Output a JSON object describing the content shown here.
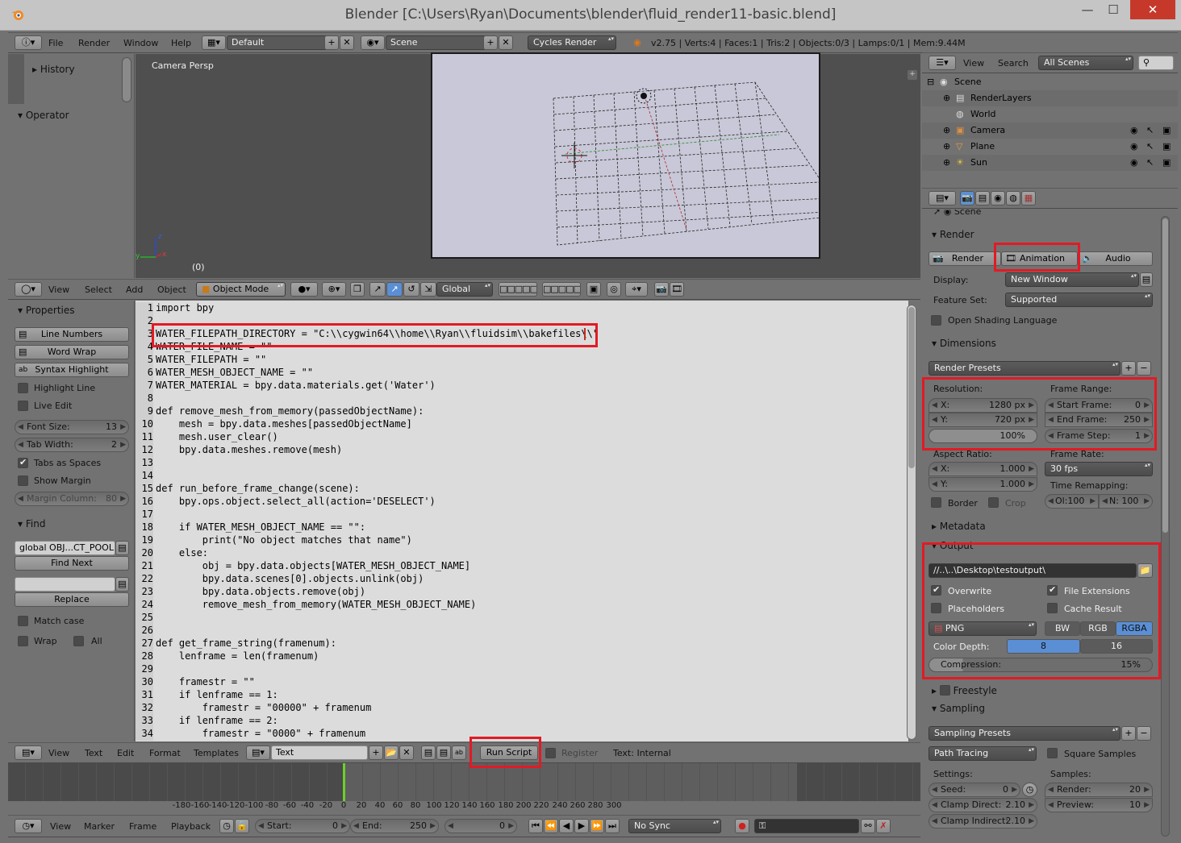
{
  "window": {
    "title": "Blender [C:\\Users\\Ryan\\Documents\\blender\\fluid_render11-basic.blend]",
    "min": "—",
    "max": "☐",
    "close": "✕"
  },
  "topmenu": {
    "file": "File",
    "render": "Render",
    "window": "Window",
    "help": "Help",
    "layout": "Default",
    "scene": "Scene",
    "engine": "Cycles Render",
    "stats": "v2.75 | Verts:4 | Faces:1 | Tris:2 | Objects:0/3 | Lamps:0/1 | Mem:9.44M"
  },
  "toolshelf": {
    "history": "History",
    "operator": "Operator"
  },
  "viewport": {
    "label": "Camera Persp",
    "frame": "(0)",
    "x": "x",
    "y": "y",
    "z": "z"
  },
  "view3d_header": {
    "view": "View",
    "select": "Select",
    "add": "Add",
    "object": "Object",
    "mode": "Object Mode",
    "orientation": "Global"
  },
  "text_props": {
    "properties": "Properties",
    "line_numbers": "Line Numbers",
    "word_wrap": "Word Wrap",
    "syntax_highlight": "Syntax Highlight",
    "highlight_line": "Highlight Line",
    "live_edit": "Live Edit",
    "font_size_label": "Font Size:",
    "font_size": "13",
    "tab_width_label": "Tab Width:",
    "tab_width": "2",
    "tabs_as_spaces": "Tabs as Spaces",
    "show_margin": "Show Margin",
    "margin_column_label": "Margin Column:",
    "margin_column": "80",
    "find": "Find",
    "find_value": "global OBJ...CT_POOL",
    "find_next": "Find Next",
    "replace": "Replace",
    "match_case": "Match case",
    "wrap": "Wrap",
    "all": "All"
  },
  "code_lines": [
    "import bpy",
    "",
    "WATER_FILEPATH_DIRECTORY = \"C:\\\\cygwin64\\\\home\\\\Ryan\\\\fluidsim\\\\bakefiles\\\\\"",
    "WATER_FILE_NAME = \"\"",
    "WATER_FILEPATH = \"\"",
    "WATER_MESH_OBJECT_NAME = \"\"",
    "WATER_MATERIAL = bpy.data.materials.get('Water')",
    "",
    "def remove_mesh_from_memory(passedObjectName):",
    "    mesh = bpy.data.meshes[passedObjectName]",
    "    mesh.user_clear()",
    "    bpy.data.meshes.remove(mesh)",
    "",
    "",
    "def run_before_frame_change(scene):",
    "    bpy.ops.object.select_all(action='DESELECT')",
    "",
    "    if WATER_MESH_OBJECT_NAME == \"\":",
    "        print(\"No object matches that name\")",
    "    else:",
    "        obj = bpy.data.objects[WATER_MESH_OBJECT_NAME]",
    "        bpy.data.scenes[0].objects.unlink(obj)",
    "        bpy.data.objects.remove(obj)",
    "        remove_mesh_from_memory(WATER_MESH_OBJECT_NAME)",
    "",
    "",
    "def get_frame_string(framenum):",
    "    lenframe = len(framenum)",
    "",
    "    framestr = \"\"",
    "    if lenframe == 1:",
    "        framestr = \"00000\" + framenum",
    "    if lenframe == 2:",
    "        framestr = \"0000\" + framenum"
  ],
  "text_header": {
    "view": "View",
    "text": "Text",
    "edit": "Edit",
    "format": "Format",
    "templates": "Templates",
    "datablock": "Text",
    "run_script": "Run Script",
    "register": "Register",
    "internal": "Text: Internal"
  },
  "timeline": {
    "ticks": [
      "-180",
      "-160",
      "-140",
      "-120",
      "-100",
      "-80",
      "-60",
      "-40",
      "-20",
      "0",
      "20",
      "40",
      "60",
      "80",
      "100",
      "120",
      "140",
      "160",
      "180",
      "200",
      "220",
      "240",
      "260",
      "280",
      "300"
    ],
    "view": "View",
    "marker": "Marker",
    "frame": "Frame",
    "playback": "Playback",
    "start_label": "Start:",
    "start": "0",
    "end_label": "End:",
    "end": "250",
    "current": "0",
    "sync": "No Sync"
  },
  "outliner": {
    "view": "View",
    "search": "Search",
    "filter": "All Scenes",
    "items": [
      {
        "label": "Scene",
        "indent": 0
      },
      {
        "label": "RenderLayers",
        "indent": 1
      },
      {
        "label": "World",
        "indent": 1
      },
      {
        "label": "Camera",
        "indent": 1
      },
      {
        "label": "Plane",
        "indent": 1
      },
      {
        "label": "Sun",
        "indent": 1
      }
    ]
  },
  "properties": {
    "breadcrumb": "Scene",
    "render_panel": "Render",
    "render_btn": "Render",
    "animation_btn": "Animation",
    "audio_btn": "Audio",
    "display_label": "Display:",
    "display_value": "New Window",
    "feature_label": "Feature Set:",
    "feature_value": "Supported",
    "osl": "Open Shading Language",
    "dimensions": "Dimensions",
    "render_presets": "Render Presets",
    "resolution": "Resolution:",
    "res_x_label": "X:",
    "res_x": "1280 px",
    "res_y_label": "Y:",
    "res_y": "720 px",
    "res_pct": "100%",
    "frame_range": "Frame Range:",
    "start_frame_label": "Start Frame:",
    "start_frame": "0",
    "end_frame_label": "End Frame:",
    "end_frame": "250",
    "frame_step_label": "Frame Step:",
    "frame_step": "1",
    "aspect": "Aspect Ratio:",
    "asp_x_label": "X:",
    "asp_x": "1.000",
    "asp_y_label": "Y:",
    "asp_y": "1.000",
    "frame_rate": "Frame Rate:",
    "fps": "30 fps",
    "time_remap": "Time Remapping:",
    "remap_old": "Ol:100",
    "remap_new": "N: 100",
    "border": "Border",
    "crop": "Crop",
    "metadata": "Metadata",
    "output": "Output",
    "output_path": "//..\\..\\Desktop\\testoutput\\",
    "overwrite": "Overwrite",
    "file_ext": "File Extensions",
    "placeholders": "Placeholders",
    "cache_result": "Cache Result",
    "format": "PNG",
    "bw": "BW",
    "rgb": "RGB",
    "rgba": "RGBA",
    "color_depth": "Color Depth:",
    "depth8": "8",
    "depth16": "16",
    "compression_label": "Compression:",
    "compression": "15%",
    "freestyle": "Freestyle",
    "sampling": "Sampling",
    "sampling_presets": "Sampling Presets",
    "integrator": "Path Tracing",
    "square_samples": "Square Samples",
    "settings": "Settings:",
    "samples": "Samples:",
    "seed_label": "Seed:",
    "seed": "0",
    "render_s_label": "Render:",
    "render_s": "20",
    "clamp_direct_label": "Clamp Direct:",
    "clamp_direct": "2.10",
    "preview_label": "Preview:",
    "preview": "10",
    "clamp_indirect_label": "Clamp Indirect:",
    "clamp_indirect": "2.10"
  },
  "colors": {
    "highlight": "#e21a24",
    "accent_blue": "#5a8fd6",
    "playhead": "#6ad12a"
  }
}
